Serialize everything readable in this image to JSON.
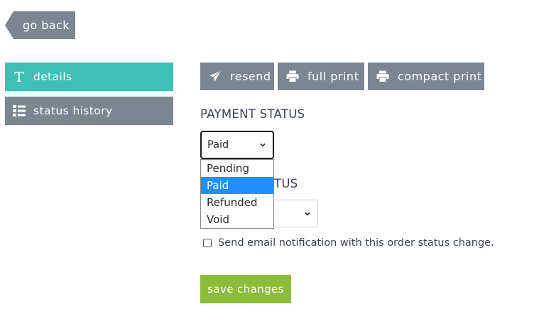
{
  "nav": {
    "go_back_label": "go back"
  },
  "sidebar": {
    "items": [
      {
        "label": "details",
        "icon": "text-t-icon",
        "active": true
      },
      {
        "label": "status history",
        "icon": "list-icon",
        "active": false
      }
    ]
  },
  "actions": {
    "resend_label": "resend",
    "full_print_label": "full print",
    "compact_print_label": "compact print"
  },
  "payment_status": {
    "label": "PAYMENT STATUS",
    "selected": "Paid",
    "options": [
      "Pending",
      "Paid",
      "Refunded",
      "Void"
    ]
  },
  "order_status": {
    "label_visible_fragment": "TUS"
  },
  "notification": {
    "label": "Send email notification with this order status change."
  },
  "save": {
    "label": "save changes"
  },
  "colors": {
    "teal": "#3fbfb5",
    "gray": "#7b8691",
    "green": "#8bbd3b",
    "highlight": "#1e90ff"
  }
}
